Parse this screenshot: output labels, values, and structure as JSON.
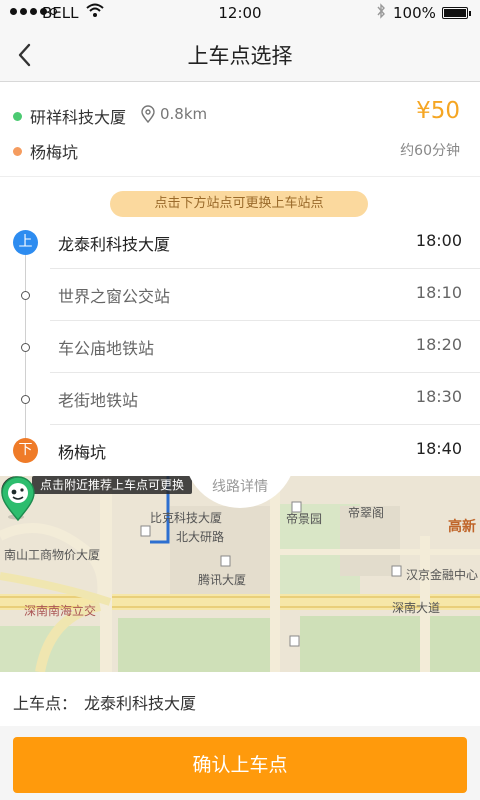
{
  "status_bar": {
    "carrier": "BELL",
    "time": "12:00",
    "battery": "100%"
  },
  "nav": {
    "title": "上车点选择"
  },
  "trip": {
    "from": "研祥科技大厦",
    "distance": "0.8km",
    "price": "¥50",
    "to": "杨梅坑",
    "duration": "约60分钟"
  },
  "stops": {
    "hint": "点击下方站点可更换上车站点",
    "items": [
      {
        "name": "龙泰利科技大厦",
        "time": "18:00",
        "badge": "上"
      },
      {
        "name": "世界之窗公交站",
        "time": "18:10"
      },
      {
        "name": "车公庙地铁站",
        "time": "18:20"
      },
      {
        "name": "老街地铁站",
        "time": "18:30"
      },
      {
        "name": "杨梅坑",
        "time": "18:40",
        "badge": "下"
      }
    ]
  },
  "map": {
    "tooltip": "点击附近推荐上车点可更换",
    "route_detail": "线路详情",
    "labels": {
      "bikeke": "比克科技大厦",
      "beida": "北大研路",
      "dijing": "帝景园",
      "dicui": "帝翠阁",
      "gaoxin": "高新",
      "nanshan": "南山工商物价大厦",
      "tengxun": "腾讯大厦",
      "hanjing": "汉京金融中心",
      "shennan_haili": "深南南海立交",
      "shennan_dadao": "深南大道"
    },
    "colors": {
      "route": "#2d6fd0",
      "green_pin": "#2dbd6e",
      "yellow_pin": "#ffd21f"
    }
  },
  "boarding": {
    "label": "上车点：",
    "value": "龙泰利科技大厦"
  },
  "confirm": {
    "label": "确认上车点"
  },
  "colors": {
    "accent": "#ff9a0c",
    "price": "#f5a623",
    "board_badge": "#2d8cf0",
    "alight_badge": "#ef7b28"
  }
}
